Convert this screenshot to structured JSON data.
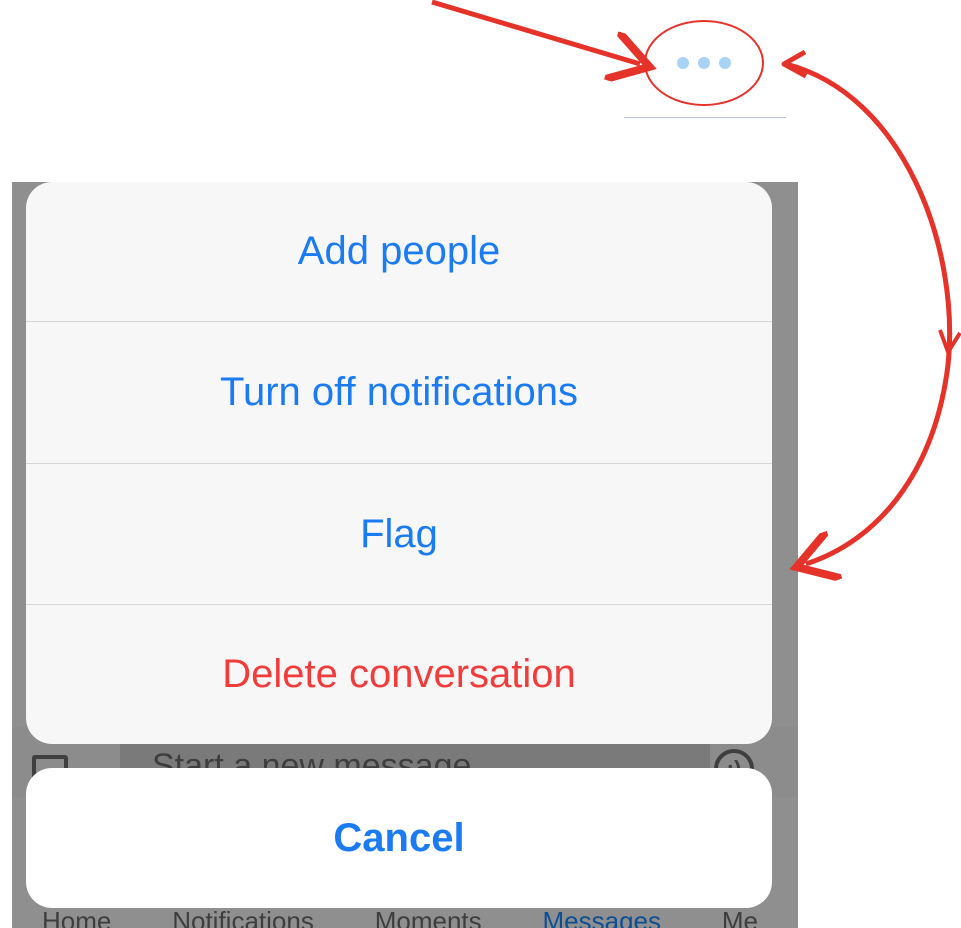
{
  "header": {
    "more_icon": "more-horizontal-icon"
  },
  "composer": {
    "placeholder": "Start a new message",
    "image_icon": "image-icon",
    "emoji_icon": "emoji-icon"
  },
  "tabs": [
    {
      "label": "Home",
      "active": false
    },
    {
      "label": "Notifications",
      "active": false
    },
    {
      "label": "Moments",
      "active": false
    },
    {
      "label": "Messages",
      "active": true
    },
    {
      "label": "Me",
      "active": false
    }
  ],
  "action_sheet": {
    "options": [
      {
        "label": "Add people",
        "destructive": false
      },
      {
        "label": "Turn off notifications",
        "destructive": false
      },
      {
        "label": "Flag",
        "destructive": false
      },
      {
        "label": "Delete conversation",
        "destructive": true
      }
    ],
    "cancel_label": "Cancel"
  },
  "colors": {
    "action_blue": "#1a7bf2",
    "destructive_red": "#f23b3b",
    "annotation_red": "#e5332a",
    "dot_blue": "#a9d3f5",
    "dim_overlay": "#8f8f8f"
  }
}
